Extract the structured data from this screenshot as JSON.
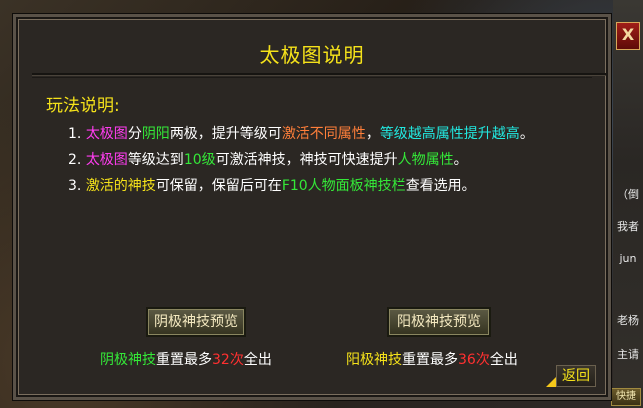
{
  "panel": {
    "title": "太极图说明",
    "section_label": "玩法说明:",
    "rules": [
      [
        {
          "t": "1. ",
          "c": "w"
        },
        {
          "t": "太极图",
          "c": "m"
        },
        {
          "t": "分",
          "c": "w"
        },
        {
          "t": "阴阳",
          "c": "g"
        },
        {
          "t": "两极，提升等级可",
          "c": "w"
        },
        {
          "t": "激活不同属性",
          "c": "o"
        },
        {
          "t": "，",
          "c": "w"
        },
        {
          "t": "等级越高属性提升越高",
          "c": "c"
        },
        {
          "t": "。",
          "c": "w"
        }
      ],
      [
        {
          "t": "2. ",
          "c": "w"
        },
        {
          "t": "太极图",
          "c": "m"
        },
        {
          "t": "等级达到",
          "c": "w"
        },
        {
          "t": "10级",
          "c": "g"
        },
        {
          "t": "可激活神技，神技可快速提升",
          "c": "w"
        },
        {
          "t": "人物属性",
          "c": "g"
        },
        {
          "t": "。",
          "c": "w"
        }
      ],
      [
        {
          "t": "3. ",
          "c": "w"
        },
        {
          "t": "激活的神技",
          "c": "y"
        },
        {
          "t": "可保留，保留后可在",
          "c": "w"
        },
        {
          "t": "F10人物面板神技栏",
          "c": "g"
        },
        {
          "t": "查看选用。",
          "c": "w"
        }
      ]
    ],
    "yin_button": "阴极神技预览",
    "yang_button": "阳极神技预览",
    "yin_reset": [
      {
        "t": "阴极神技",
        "c": "g"
      },
      {
        "t": "重置最多",
        "c": "w"
      },
      {
        "t": "32次",
        "c": "r"
      },
      {
        "t": "全出",
        "c": "w"
      }
    ],
    "yang_reset": [
      {
        "t": "阳极神技",
        "c": "y"
      },
      {
        "t": "重置最多",
        "c": "w"
      },
      {
        "t": "36次",
        "c": "r"
      },
      {
        "t": "全出",
        "c": "w"
      }
    ],
    "back_button": "返回",
    "close_glyph": "X"
  },
  "side": {
    "items": [
      "（倒",
      "我者",
      "jun",
      "老杨",
      "主请"
    ],
    "quick": "快捷"
  }
}
